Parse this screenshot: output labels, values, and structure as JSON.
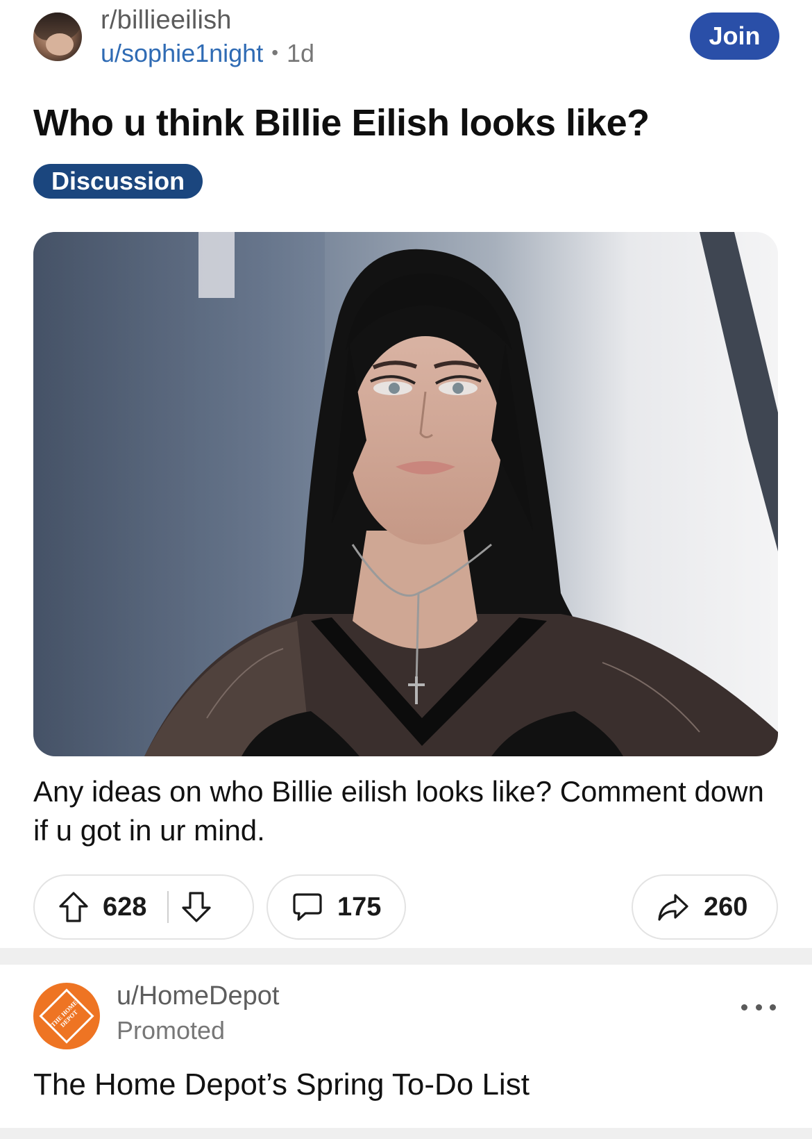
{
  "post": {
    "subreddit": "r/billieeilish",
    "author": "u/sophie1night",
    "separator": "•",
    "age": "1d",
    "join_label": "Join",
    "title": "Who u think Billie Eilish looks like?",
    "flair": "Discussion",
    "body": "Any ideas on who Billie eilish looks like? Comment down if u got in ur mind.",
    "actions": {
      "upvotes": "628",
      "comments": "175",
      "shares": "260"
    }
  },
  "promoted": {
    "author": "u/HomeDepot",
    "label": "Promoted",
    "logo_text": "THE HOME DEPOT",
    "title": "The Home Depot’s Spring To-Do List"
  },
  "icons": {
    "upvote": "arrow-up-icon",
    "downvote": "arrow-down-icon",
    "comment": "speech-bubble-icon",
    "share": "share-arrow-icon",
    "more": "ellipsis-icon"
  },
  "colors": {
    "join_button": "#2a4fa8",
    "flair": "#1b467e",
    "author_link": "#2f6bb4",
    "home_depot_orange": "#ee7423"
  }
}
